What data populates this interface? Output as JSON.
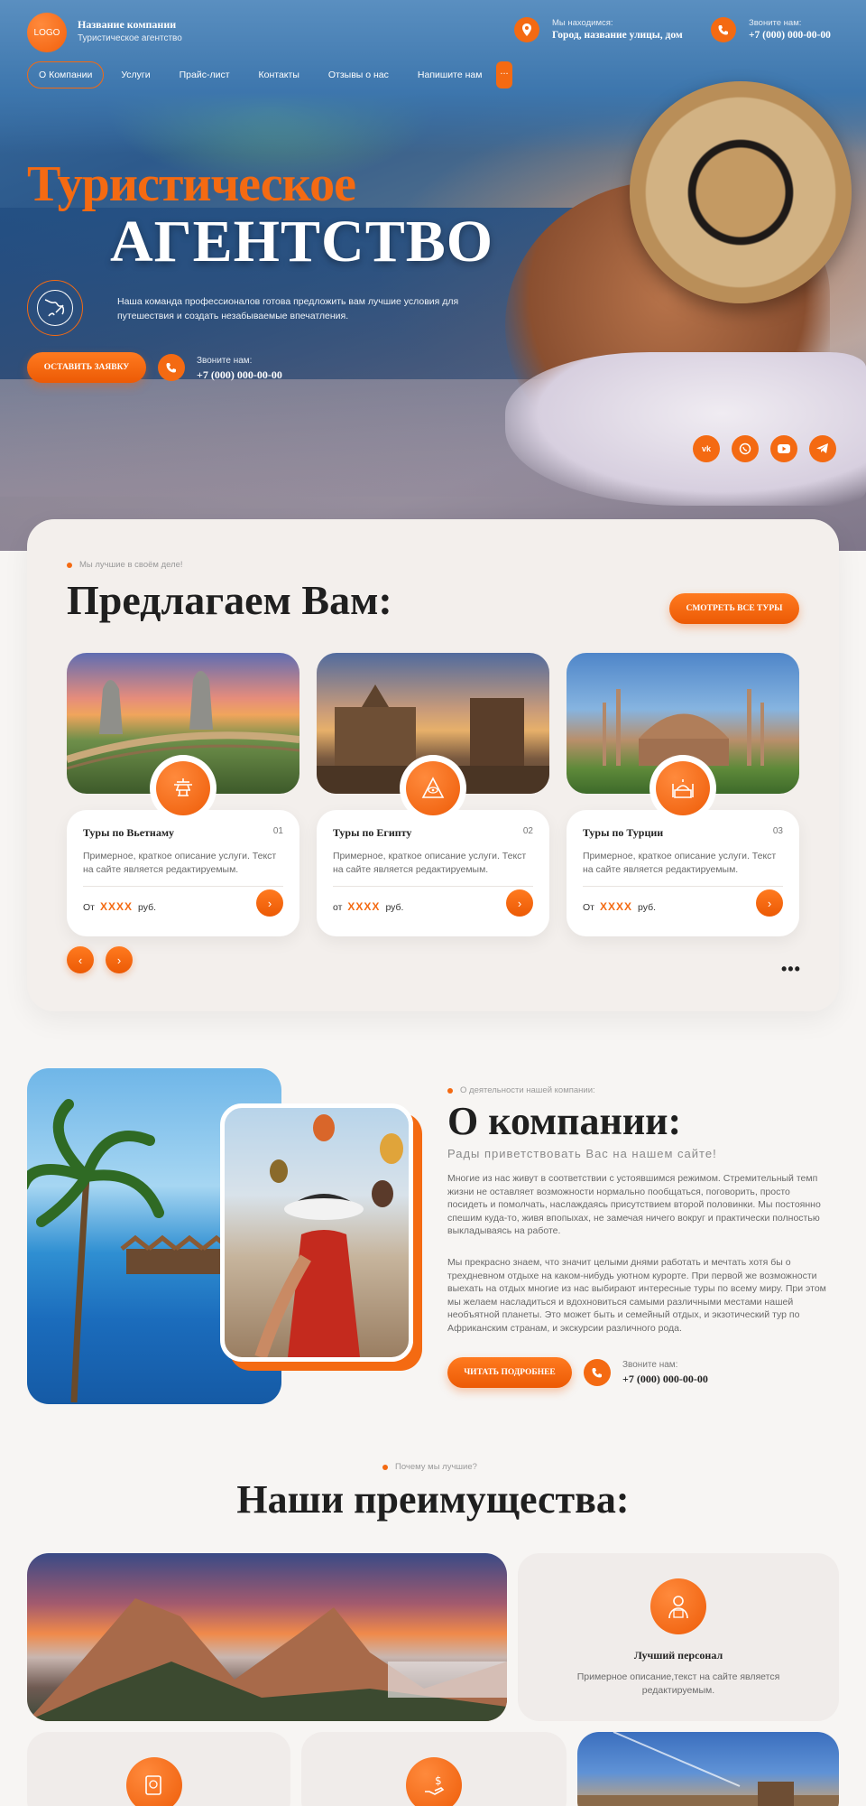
{
  "header": {
    "logo": "LOGO",
    "company_name": "Название компании",
    "company_sub": "Туристическое агентство",
    "location_label": "Мы находимся:",
    "location_value": "Город, название улицы, дом",
    "call_label": "Звоните нам:",
    "phone": "+7 (000) 000-00-00"
  },
  "nav": {
    "items": [
      "О Компании",
      "Услуги",
      "Прайс-лист",
      "Контакты",
      "Отзывы о нас",
      "Напишите нам"
    ],
    "more": "..."
  },
  "hero": {
    "title_line1": "Туристическое",
    "title_line2": "АГЕНТСТВО",
    "description": "Наша команда профессионалов готова предложить вам лучшие условия для путешествия и создать незабываемые впечатления.",
    "cta": "ОСТАВИТЬ ЗАЯВКУ",
    "call_label": "Звоните нам:",
    "phone": "+7 (000) 000-00-00",
    "socials": [
      "vk",
      "wa",
      "yt",
      "tg"
    ]
  },
  "offer": {
    "eyebrow": "Мы лучшие в своём деле!",
    "title": "Предлагаем Вам:",
    "all_tours": "СМОТРЕТЬ ВСЕ ТУРЫ",
    "cards": [
      {
        "title": "Туры по Вьетнаму",
        "num": "01",
        "desc": "Примерное, краткое описание услуги. Текст на сайте является редактируемым.",
        "price_prefix": "От",
        "price": "XXXX",
        "price_suffix": "руб.",
        "icon": "pagoda-icon"
      },
      {
        "title": "Туры по Египту",
        "num": "02",
        "desc": "Примерное, краткое описание услуги. Текст на сайте является редактируемым.",
        "price_prefix": "от",
        "price": "XXXX",
        "price_suffix": "руб.",
        "icon": "pyramid-eye-icon"
      },
      {
        "title": "Туры по Турции",
        "num": "03",
        "desc": "Примерное, краткое описание услуги. Текст на сайте является редактируемым.",
        "price_prefix": "От",
        "price": "XXXX",
        "price_suffix": "руб.",
        "icon": "mosque-icon"
      }
    ],
    "dots": "•••"
  },
  "about": {
    "eyebrow": "О деятельности нашей компании:",
    "title": "О компании:",
    "subtitle": "Рады приветствовать Вас на нашем сайте!",
    "para1": "Многие из нас живут в соответствии с устоявшимся режимом. Стремительный темп жизни не оставляет возможности нормально пообщаться, поговорить, просто посидеть и помолчать, наслаждаясь присутствием второй половинки. Мы постоянно спешим куда-то, живя впопыхах, не замечая ничего вокруг и практически полностью выкладываясь на работе.",
    "para2": "Мы прекрасно знаем, что значит целыми днями работать и мечтать хотя бы о трехдневном отдыхе на каком-нибудь уютном курорте. При первой же возможности выехать на отдых многие из нас выбирают интересные туры по всему миру. При этом мы желаем насладиться и вдохновиться самыми различными местами нашей необъятной планеты. Это может быть и семейный отдых, и экзотический тур по Африканским странам, и экскурсии различного рода.",
    "cta": "ЧИТАТЬ ПОДРОБНЕЕ",
    "call_label": "Звоните нам:",
    "phone": "+7 (000) 000-00-00"
  },
  "advantages": {
    "eyebrow": "Почему мы лучшие?",
    "title": "Наши преимущества:",
    "staff_title": "Лучший персонал",
    "staff_desc": "Примерное описание,текст на сайте является редактируемым."
  },
  "colors": {
    "accent": "#f46a12",
    "background": "#f7f5f3",
    "card": "#ffffff"
  }
}
